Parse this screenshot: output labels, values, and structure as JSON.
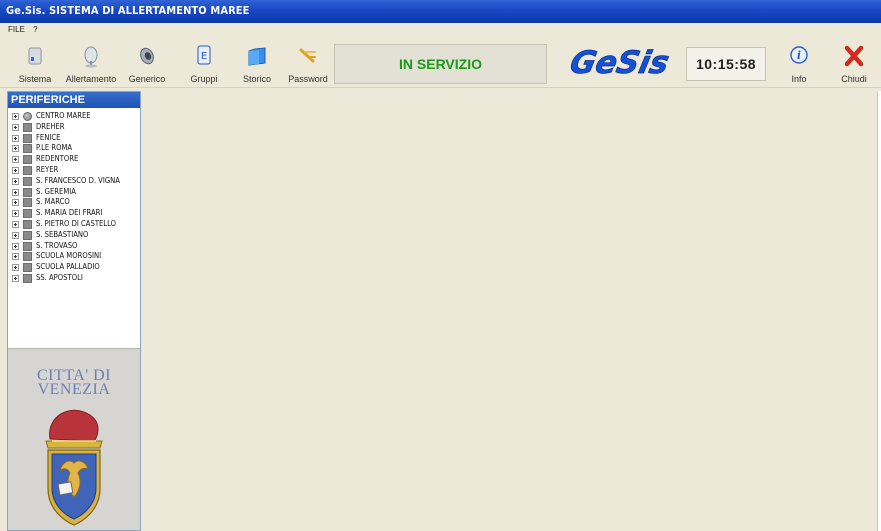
{
  "window": {
    "title": "Ge.Sis. SISTEMA DI ALLERTAMENTO MAREE"
  },
  "menu": {
    "items": [
      "FILE",
      "?"
    ]
  },
  "toolbar": {
    "buttons": [
      {
        "label": "Sistema",
        "icon": "system-icon"
      },
      {
        "label": "Allertamento",
        "icon": "alert-icon"
      },
      {
        "label": "Generico",
        "icon": "speaker-icon"
      },
      {
        "label": "Gruppi",
        "icon": "groups-icon"
      },
      {
        "label": "Storico",
        "icon": "folder-icon"
      },
      {
        "label": "Password",
        "icon": "key-icon"
      }
    ],
    "status": "IN SERVIZIO",
    "logo": "GeSis",
    "clock": "10:15:58",
    "info_label": "Info",
    "close_label": "Chiudi"
  },
  "sidebar": {
    "header": "PERIFERICHE",
    "items": [
      "CENTRO MAREE",
      "DREHER",
      "FENICE",
      "P.LE ROMA",
      "REDENTORE",
      "REYER",
      "S. FRANCESCO D. VIGNA",
      "S. GEREMIA",
      "S. MARCO",
      "S. MARIA DEI FRARI",
      "S. PIETRO DI CASTELLO",
      "S. SEBASTIANO",
      "S. TROVASO",
      "SCUOLA MOROSINI",
      "SCUOLA PALLADIO",
      "SS. APOSTOLI"
    ],
    "crest_text": "CITTA' DI VENEZIA"
  },
  "colors": {
    "titlebar": "#1748c2",
    "status_text": "#1a9a17",
    "logo_blue": "#1450d8",
    "close_red": "#d42a1d"
  }
}
